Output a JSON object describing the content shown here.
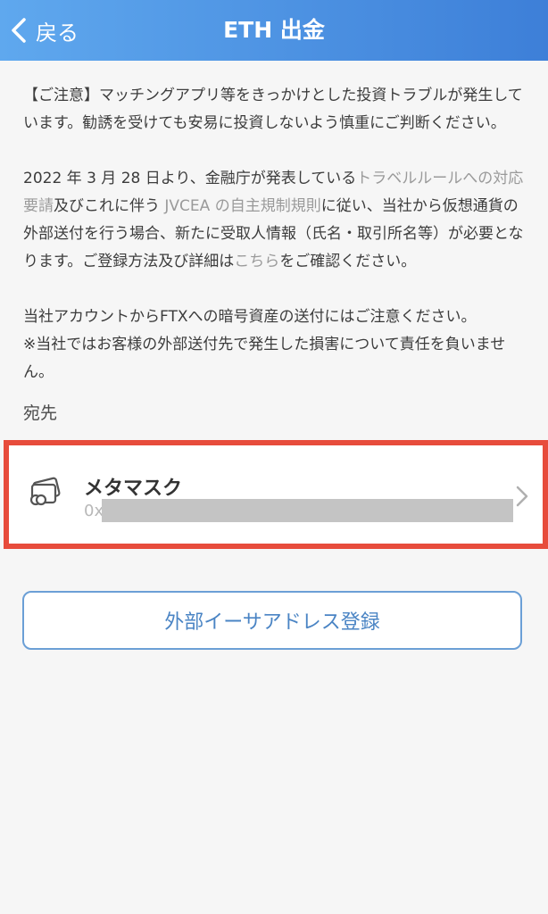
{
  "header": {
    "back_label": "戻る",
    "title": "ETH 出金"
  },
  "notice": {
    "p1": "【ご注意】マッチングアプリ等をきっかけとした投資トラブルが発生しています。勧誘を受けても安易に投資しないよう慎重にご判断ください。",
    "p2_a": "2022 年 3 月 28 日より、金融庁が発表している",
    "p2_link1": "トラベルルールへの対応要請",
    "p2_b": "及びこれに伴う ",
    "p2_link2": "JVCEA の自主規制規則",
    "p2_c": "に従い、当社から仮想通貨の外部送付を行う場合、新たに受取人情報（氏名・取引所名等）が必要となります。ご登録方法及び詳細は",
    "p2_link3": "こちら",
    "p2_d": "をご確認ください。",
    "p3": "当社アカウントからFTXへの暗号資産の送付にはご注意ください。",
    "p4": "※当社ではお客様の外部送付先で発生した損害について責任を負いません。"
  },
  "destination": {
    "section_label": "宛先",
    "name": "メタマスク",
    "address_prefix": "0x",
    "icon": "wallet-icon"
  },
  "add_button_label": "外部イーサアドレス登録",
  "colors": {
    "header_start": "#5fa8ee",
    "header_end": "#3d7fd8",
    "highlight_border": "#e74c3c",
    "button_border": "#6b9fd6",
    "button_text": "#4a84c4",
    "link_text": "#9a9a9a"
  }
}
